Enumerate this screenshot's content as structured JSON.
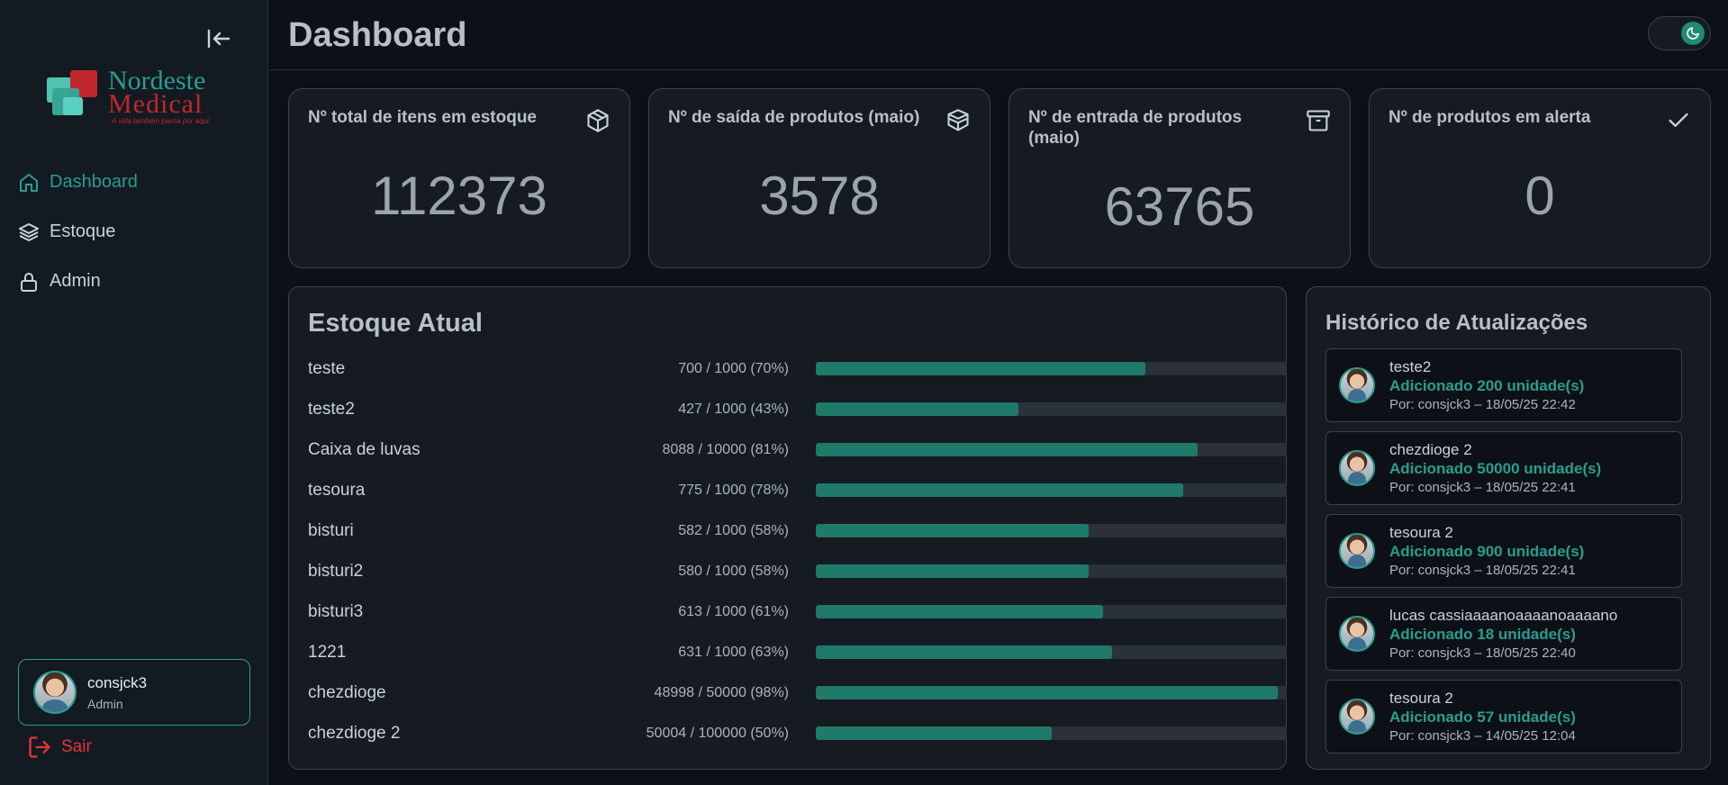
{
  "sidebar": {
    "logo": {
      "line1": "Nordeste",
      "line2": "Medical",
      "slogan": "A vida também passa por aqui"
    },
    "nav": [
      {
        "label": "Dashboard",
        "icon": "home-icon",
        "active": true
      },
      {
        "label": "Estoque",
        "icon": "layers-icon",
        "active": false
      },
      {
        "label": "Admin",
        "icon": "lock-icon",
        "active": false
      }
    ],
    "user": {
      "name": "consjck3",
      "role": "Admin"
    },
    "logout_label": "Sair"
  },
  "header": {
    "title": "Dashboard"
  },
  "stats": [
    {
      "label": "Nº total de itens em estoque",
      "value": "112373",
      "icon": "package-icon"
    },
    {
      "label": "Nº de saída de produtos (maio)",
      "value": "3578",
      "icon": "boxes-icon"
    },
    {
      "label": "Nº de entrada de produtos (maio)",
      "value": "63765",
      "icon": "archive-icon"
    },
    {
      "label": "Nº de produtos em alerta",
      "value": "0",
      "icon": "check-icon"
    }
  ],
  "estoque": {
    "title": "Estoque Atual",
    "items": [
      {
        "name": "teste",
        "info": "700 / 1000 (70%)",
        "percent": 70
      },
      {
        "name": "teste2",
        "info": "427 / 1000 (43%)",
        "percent": 43
      },
      {
        "name": "Caixa de luvas",
        "info": "8088 / 10000 (81%)",
        "percent": 81
      },
      {
        "name": "tesoura",
        "info": "775 / 1000 (78%)",
        "percent": 78
      },
      {
        "name": "bisturi",
        "info": "582 / 1000 (58%)",
        "percent": 58
      },
      {
        "name": "bisturi2",
        "info": "580 / 1000 (58%)",
        "percent": 58
      },
      {
        "name": "bisturi3",
        "info": "613 / 1000 (61%)",
        "percent": 61
      },
      {
        "name": "1221",
        "info": "631 / 1000 (63%)",
        "percent": 63
      },
      {
        "name": "chezdioge",
        "info": "48998 / 50000 (98%)",
        "percent": 98
      },
      {
        "name": "chezdioge 2",
        "info": "50004 / 100000 (50%)",
        "percent": 50
      }
    ]
  },
  "historico": {
    "title": "Histórico de Atualizações",
    "items": [
      {
        "name": "teste2",
        "action": "Adicionado 200 unidade(s)",
        "by": "Por: consjck3 – 18/05/25 22:42"
      },
      {
        "name": "chezdioge 2",
        "action": "Adicionado 50000 unidade(s)",
        "by": "Por: consjck3 – 18/05/25 22:41"
      },
      {
        "name": "tesoura 2",
        "action": "Adicionado 900 unidade(s)",
        "by": "Por: consjck3 – 18/05/25 22:41"
      },
      {
        "name": "lucas cassiaaaanoaaaanoaaaano",
        "action": "Adicionado 18 unidade(s)",
        "by": "Por: consjck3 – 18/05/25 22:40"
      },
      {
        "name": "tesoura 2",
        "action": "Adicionado 57 unidade(s)",
        "by": "Por: consjck3 – 14/05/25 12:04"
      }
    ]
  },
  "colors": {
    "accent": "#2a9d8f",
    "danger": "#e0353b",
    "background": "#0d1117",
    "card": "#161b22"
  }
}
